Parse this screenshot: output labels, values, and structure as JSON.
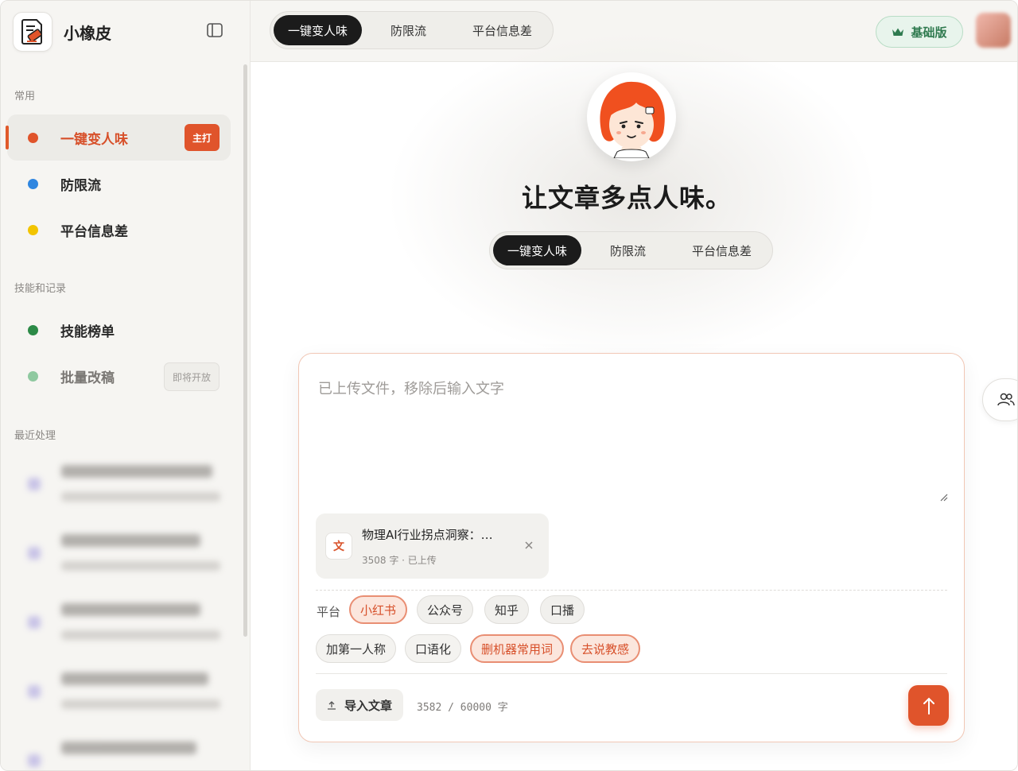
{
  "app": {
    "name": "小橡皮"
  },
  "sidebar": {
    "sections": {
      "common": "常用",
      "skills": "技能和记录",
      "recent": "最近处理"
    },
    "common_items": [
      {
        "label": "一键变人味",
        "dot_color": "#e0542b",
        "badge": "主打",
        "active": true
      },
      {
        "label": "防限流",
        "dot_color": "#2f86e0"
      },
      {
        "label": "平台信息差",
        "dot_color": "#f2c400"
      }
    ],
    "skill_items": [
      {
        "label": "技能榜单",
        "dot_color": "#2c8a47"
      },
      {
        "label": "批量改稿",
        "dot_color": "#8fc9a0",
        "badge": "即将开放"
      }
    ]
  },
  "topbar": {
    "tabs": [
      "一键变人味",
      "防限流",
      "平台信息差"
    ],
    "active_tab": "一键变人味",
    "plan_label": "基础版",
    "plan_icon": "crown-icon"
  },
  "main": {
    "headline": "让文章多点人味。",
    "tabs": [
      "一键变人味",
      "防限流",
      "平台信息差"
    ],
    "active_tab": "一键变人味",
    "editor": {
      "placeholder": "已上传文件，移除后输入文字",
      "file": {
        "icon_text": "文",
        "name": "物理AI行业拐点洞察：…",
        "meta": "3508 字 · 已上传"
      },
      "platform_label": "平台",
      "platforms": [
        {
          "label": "小红书",
          "selected": true
        },
        {
          "label": "公众号",
          "selected": false
        },
        {
          "label": "知乎",
          "selected": false
        },
        {
          "label": "口播",
          "selected": false
        }
      ],
      "options": [
        {
          "label": "加第一人称",
          "selected": false
        },
        {
          "label": "口语化",
          "selected": false
        },
        {
          "label": "删机器常用词",
          "selected": true
        },
        {
          "label": "去说教感",
          "selected": true
        }
      ],
      "import_label": "导入文章",
      "word_count": "3582 / 60000 字"
    }
  },
  "colors": {
    "accent": "#e0542b",
    "plan_green": "#2f7a4f",
    "dark_tab": "#1b1b1b"
  }
}
